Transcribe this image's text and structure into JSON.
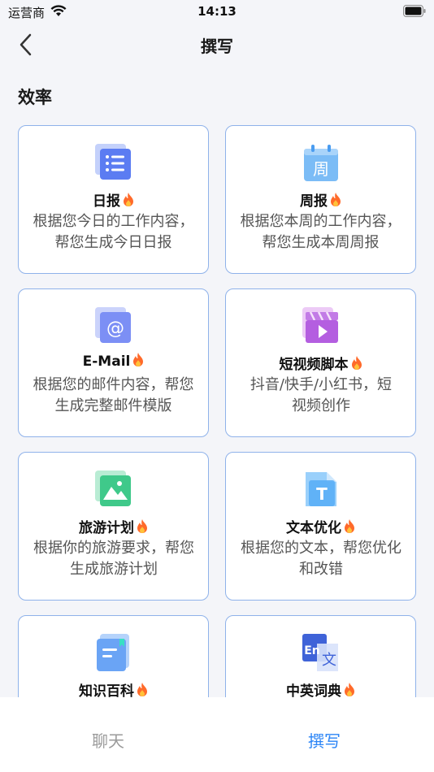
{
  "status": {
    "carrier": "运营商",
    "time": "14:13"
  },
  "nav": {
    "title": "撰写"
  },
  "section": {
    "title": "效率"
  },
  "cards": [
    {
      "title": "日报",
      "desc": "根据您今日的工作内容，帮您生成今日日报",
      "icon": "list-doc-icon"
    },
    {
      "title": "周报",
      "desc": "根据您本周的工作内容，帮您生成本周周报",
      "icon": "week-calendar-icon",
      "icon_text": "周"
    },
    {
      "title": "E-Mail",
      "desc": "根据您的邮件内容，帮您生成完整邮件模版",
      "icon": "at-mail-icon",
      "icon_text": "@"
    },
    {
      "title": "短视频脚本",
      "desc": "抖音/快手/小红书，短视频创作",
      "icon": "video-clapper-icon"
    },
    {
      "title": "旅游计划",
      "desc": "根据你的旅游要求，帮您生成旅游计划",
      "icon": "landscape-image-icon"
    },
    {
      "title": "文本优化",
      "desc": "根据您的文本，帮您优化和改错",
      "icon": "text-doc-icon",
      "icon_text": "T"
    },
    {
      "title": "知识百科",
      "desc": "",
      "icon": "book-icon"
    },
    {
      "title": "中英词典",
      "desc": "",
      "icon": "translate-icon",
      "icon_text": "En",
      "icon_text2": "文"
    }
  ],
  "tabs": {
    "chat": "聊天",
    "write": "撰写"
  },
  "colors": {
    "accent": "#2a84f6",
    "card_border": "#8fb2ea",
    "fire": "#ff6a2a"
  }
}
